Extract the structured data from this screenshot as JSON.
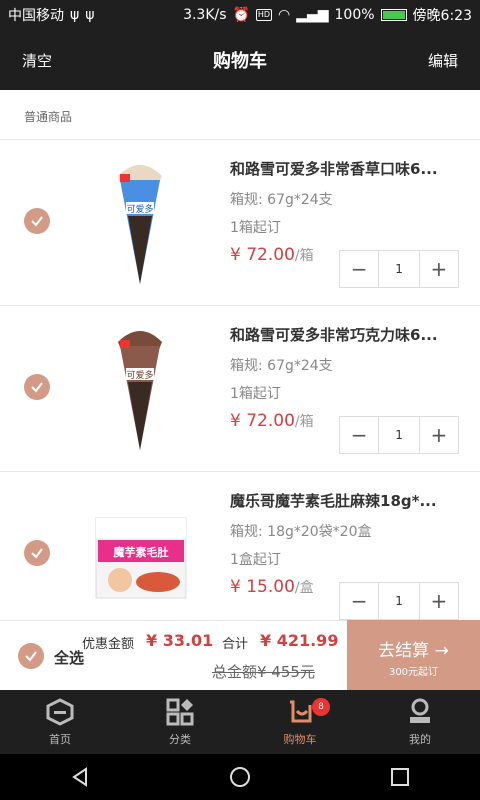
{
  "status": {
    "carrier": "中国移动",
    "speed": "3.3K/s",
    "battery": "100%",
    "time": "傍晚6:23"
  },
  "header": {
    "left_label": "清空",
    "title": "购物车",
    "right_label": "编辑"
  },
  "section": {
    "label": "普通商品"
  },
  "items": [
    {
      "name": "和路雪可爱多非常香草口味6...",
      "spec": "箱规: 67g*24支",
      "moq": "1箱起订",
      "price": "¥ 72.00",
      "unit": "/箱",
      "qty": "1"
    },
    {
      "name": "和路雪可爱多非常巧克力味6...",
      "spec": "箱规: 67g*24支",
      "moq": "1箱起订",
      "price": "¥ 72.00",
      "unit": "/箱",
      "qty": "1"
    },
    {
      "name": "魔乐哥魔芋素毛肚麻辣18g*...",
      "spec": "箱规: 18g*20袋*20盒",
      "moq": "1盒起订",
      "price": "¥ 15.00",
      "unit": "/盒",
      "qty": "1"
    }
  ],
  "summary": {
    "select_all": "全选",
    "discount_label": "优惠金额",
    "discount_value": "¥ 33.01",
    "total_label": "合计",
    "total_value": "¥ 421.99",
    "gross": "总金额¥ 455元",
    "checkout_label": "去结算 →",
    "checkout_sub": "300元起订"
  },
  "tabs": [
    {
      "label": "首页",
      "icon": "home-icon"
    },
    {
      "label": "分类",
      "icon": "category-icon"
    },
    {
      "label": "购物车",
      "icon": "cart-icon",
      "badge": "8",
      "active": true
    },
    {
      "label": "我的",
      "icon": "profile-icon"
    }
  ],
  "colors": {
    "accent": "#d39a86",
    "price": "#d34040",
    "dark": "#1f1f1f"
  }
}
